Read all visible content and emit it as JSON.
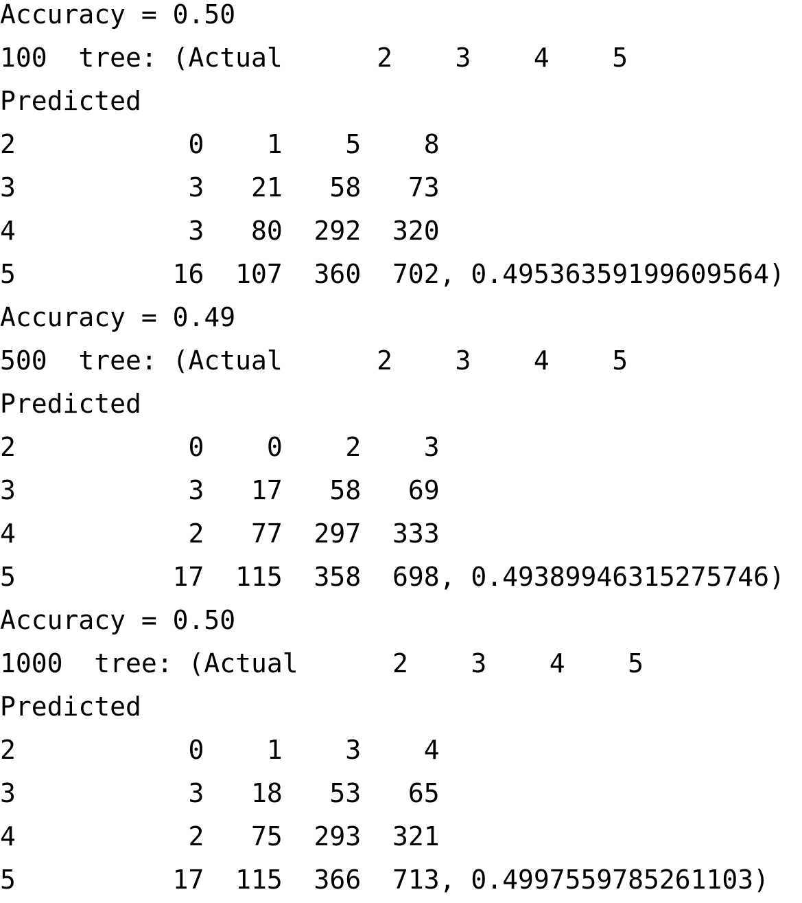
{
  "console": {
    "lines": [
      "Accuracy = 0.50",
      "100  tree: (Actual      2    3    4    5",
      "Predicted",
      "2           0    1    5    8",
      "3           3   21   58   73",
      "4           3   80  292  320",
      "5          16  107  360  702, 0.4953635919960956⁣",
      "Accuracy = 0.49",
      "500  tree: (Actual      2    3    4    5",
      "Predicted",
      "2           0    0    2    3",
      "3           3   17   58   69",
      "4           2   77  297  333",
      "5          17  115  358  698, 0.4938994631527574⁣",
      "Accuracy = 0.50",
      "1000  tree: (Actual      2    3    4    5",
      "Predicted",
      "2           0    1    3    4",
      "3           3   18   53   65",
      "4           2   75  293  321",
      "5          17  115  366  713, 0.4997559785261103)"
    ]
  }
}
